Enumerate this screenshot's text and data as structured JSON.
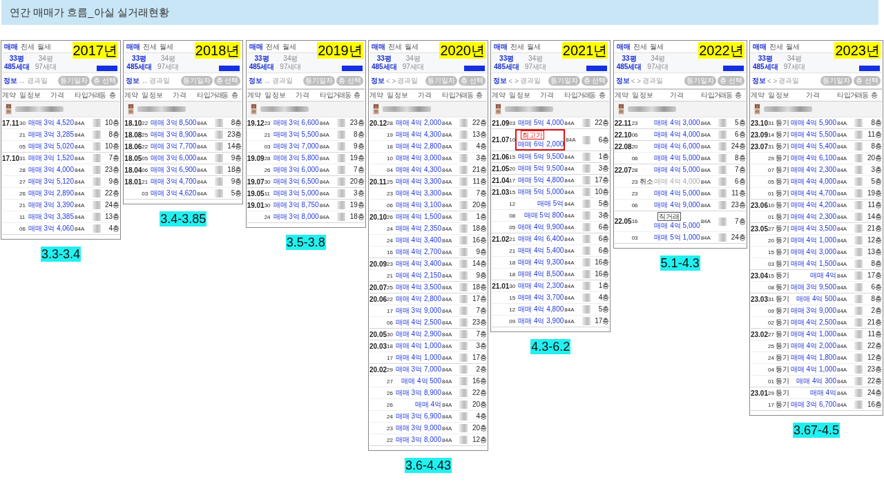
{
  "title": "연간 매매가 흐름_아실 실거래현황",
  "panels": [
    {
      "year": "2017년",
      "range": "3.3-3.4",
      "tabs": [
        {
          "label": "매매",
          "selected": true
        },
        {
          "label": "전세",
          "selected": false
        },
        {
          "label": "월세",
          "selected": false
        }
      ],
      "areas": [
        {
          "size": "33평",
          "units": "485세대",
          "selected": true
        },
        {
          "size": "34평",
          "units": "97세대",
          "selected": false
        }
      ],
      "filter": {
        "info": "정보",
        "separator": "↔",
        "elapsed": "경과일"
      },
      "buttons": [
        "등기일자",
        "층 선택"
      ],
      "columns": [
        "계약",
        "일",
        "정보",
        "가격",
        "타입",
        "거래동",
        "층"
      ],
      "months": [
        {
          "month": "17.11",
          "rows": [
            {
              "day": "30",
              "deal": "매매",
              "price": "3억 4,520",
              "type": "84A",
              "floor": "10층"
            },
            {
              "day": "21",
              "deal": "매매",
              "price": "3억 3,285",
              "type": "84A",
              "floor": "8층"
            },
            {
              "day": "05",
              "deal": "매매",
              "price": "3억 5,020",
              "type": "84A",
              "floor": "10층"
            }
          ]
        },
        {
          "month": "17.10",
          "rows": [
            {
              "day": "31",
              "deal": "매매",
              "price": "3억 1,520",
              "type": "84A",
              "floor": "7층"
            },
            {
              "day": "28",
              "deal": "매매",
              "price": "3억 4,000",
              "type": "84A",
              "floor": "23층"
            },
            {
              "day": "27",
              "deal": "매매",
              "price": "3억 5,120",
              "type": "84A",
              "floor": "9층"
            },
            {
              "day": "26",
              "deal": "매매",
              "price": "3억 2,890",
              "type": "84A",
              "floor": "22층"
            },
            {
              "day": "21",
              "deal": "매매",
              "price": "3억 3,390",
              "type": "84A",
              "floor": "24층"
            },
            {
              "day": "11",
              "deal": "매매",
              "price": "3억 3,385",
              "type": "84A",
              "floor": "13층"
            },
            {
              "day": "06",
              "deal": "매매",
              "price": "3억 4,060",
              "type": "84A",
              "floor": "4층"
            }
          ]
        }
      ]
    },
    {
      "year": "2018년",
      "range": "3.4-3.85",
      "tabs": [
        {
          "label": "매매",
          "selected": true
        },
        {
          "label": "전세",
          "selected": false
        },
        {
          "label": "월세",
          "selected": false
        }
      ],
      "areas": [
        {
          "size": "33평",
          "units": "485세대",
          "selected": true
        },
        {
          "size": "34평",
          "units": "97세대",
          "selected": false
        }
      ],
      "filter": {
        "info": "정보",
        "separator": "↔",
        "elapsed": "경과일"
      },
      "buttons": [
        "등기일자",
        "층 선택"
      ],
      "columns": [
        "계약",
        "일",
        "정보",
        "가격",
        "타입",
        "거래동",
        "층"
      ],
      "months": [
        {
          "month": "18.10",
          "rows": [
            {
              "day": "22",
              "deal": "매매",
              "price": "3억 8,500",
              "type": "84A",
              "floor": "8층"
            }
          ]
        },
        {
          "month": "18.08",
          "rows": [
            {
              "day": "25",
              "deal": "매매",
              "price": "3억 8,900",
              "type": "84A",
              "floor": "23층"
            }
          ]
        },
        {
          "month": "18.06",
          "rows": [
            {
              "day": "22",
              "deal": "매매",
              "price": "3억 7,700",
              "type": "84A",
              "floor": "14층"
            }
          ]
        },
        {
          "month": "18.05",
          "rows": [
            {
              "day": "05",
              "deal": "매매",
              "price": "3억 6,000",
              "type": "84A",
              "floor": "9층"
            }
          ]
        },
        {
          "month": "18.04",
          "rows": [
            {
              "day": "06",
              "deal": "매매",
              "price": "3억 6,900",
              "type": "84A",
              "floor": "18층"
            }
          ]
        },
        {
          "month": "18.01",
          "rows": [
            {
              "day": "21",
              "deal": "매매",
              "price": "3억 4,700",
              "type": "84A",
              "floor": "9층"
            },
            {
              "day": "03",
              "deal": "매매",
              "price": "3억 4,620",
              "type": "84A",
              "floor": "5층"
            }
          ]
        }
      ]
    },
    {
      "year": "2019년",
      "range": "3.5-3.8",
      "tabs": [
        {
          "label": "매매",
          "selected": true
        },
        {
          "label": "전세",
          "selected": false
        },
        {
          "label": "월세",
          "selected": false
        }
      ],
      "areas": [
        {
          "size": "33평",
          "units": "485세대",
          "selected": true
        },
        {
          "size": "34평",
          "units": "97세대",
          "selected": false
        }
      ],
      "filter": {
        "info": "정보",
        "separator": "↔",
        "elapsed": "경과일"
      },
      "buttons": [
        "등기일자",
        "층 선택"
      ],
      "columns": [
        "계약",
        "일",
        "정보",
        "가격",
        "타입",
        "거래동",
        "층"
      ],
      "months": [
        {
          "month": "19.12",
          "rows": [
            {
              "day": "23",
              "deal": "매매",
              "price": "3억 6,600",
              "type": "84A",
              "floor": "23층"
            },
            {
              "day": "21",
              "deal": "매매",
              "price": "3억 5,500",
              "type": "84A",
              "floor": "8층"
            },
            {
              "day": "03",
              "deal": "매매",
              "price": "3억 7,000",
              "type": "84A",
              "floor": "9층"
            }
          ]
        },
        {
          "month": "19.09",
          "rows": [
            {
              "day": "28",
              "deal": "매매",
              "price": "3억 5,800",
              "type": "84A",
              "floor": "19층"
            },
            {
              "day": "26",
              "deal": "매매",
              "price": "3억 6,000",
              "type": "84A",
              "floor": "7층"
            }
          ]
        },
        {
          "month": "19.07",
          "rows": [
            {
              "day": "30",
              "deal": "매매",
              "price": "3억 6,500",
              "type": "84A",
              "floor": "20층"
            }
          ]
        },
        {
          "month": "19.05",
          "rows": [
            {
              "day": "11",
              "deal": "매매",
              "price": "3억 5,000",
              "type": "84A",
              "floor": "3층"
            }
          ]
        },
        {
          "month": "19.01",
          "rows": [
            {
              "day": "30",
              "deal": "매매",
              "price": "3억 8,750",
              "type": "84A",
              "floor": "19층"
            },
            {
              "day": "24",
              "deal": "매매",
              "price": "3억 8,000",
              "type": "84A",
              "floor": "18층"
            }
          ]
        }
      ]
    },
    {
      "year": "2020년",
      "range": "3.6-4.43",
      "tabs": [
        {
          "label": "매매",
          "selected": true
        },
        {
          "label": "전세",
          "selected": false
        },
        {
          "label": "월세",
          "selected": false
        }
      ],
      "areas": [
        {
          "size": "33평",
          "units": "485세대",
          "selected": true
        },
        {
          "size": "34평",
          "units": "97세대",
          "selected": false
        }
      ],
      "filter": {
        "info": "정보",
        "separator": "< >",
        "elapsed": "경과일"
      },
      "buttons": [
        "등기일자",
        "층 선택"
      ],
      "columns": [
        "계약",
        "일",
        "정보",
        "가격",
        "타입",
        "거래동",
        "층"
      ],
      "months": [
        {
          "month": "20.12",
          "rows": [
            {
              "day": "28",
              "deal": "매매",
              "price": "4억 2,000",
              "type": "84A",
              "floor": "22층"
            },
            {
              "day": "19",
              "deal": "매매",
              "price": "4억 4,300",
              "type": "84A",
              "floor": "13층"
            },
            {
              "day": "18",
              "deal": "매매",
              "price": "4억 2,800",
              "type": "84A",
              "floor": "4층"
            },
            {
              "day": "10",
              "deal": "매매",
              "price": "4억 3,000",
              "type": "84A",
              "floor": "3층"
            },
            {
              "day": "04",
              "deal": "매매",
              "price": "4억 4,300",
              "type": "84A",
              "floor": "21층"
            }
          ]
        },
        {
          "month": "20.11",
          "rows": [
            {
              "day": "25",
              "deal": "매매",
              "price": "4억 3,300",
              "type": "84A",
              "floor": "11층"
            },
            {
              "day": "23",
              "deal": "매매",
              "price": "4억 3,300",
              "type": "84A",
              "floor": "7층"
            },
            {
              "day": "06",
              "deal": "매매",
              "price": "4억 3,100",
              "type": "84A",
              "floor": "20층"
            }
          ]
        },
        {
          "month": "20.10",
          "rows": [
            {
              "day": "26",
              "deal": "매매",
              "price": "4억 1,500",
              "type": "84A",
              "floor": "1층"
            },
            {
              "day": "24",
              "deal": "매매",
              "price": "4억 2,350",
              "type": "84A",
              "floor": "18층"
            },
            {
              "day": "24",
              "deal": "매매",
              "price": "4억 3,400",
              "type": "84A",
              "floor": "16층"
            },
            {
              "day": "16",
              "deal": "매매",
              "price": "4억 2,700",
              "type": "84A",
              "floor": "9층"
            }
          ]
        },
        {
          "month": "20.09",
          "rows": [
            {
              "day": "23",
              "deal": "매매",
              "price": "4억 3,400",
              "type": "84A",
              "floor": "14층"
            },
            {
              "day": "21",
              "deal": "매매",
              "price": "4억 2,150",
              "type": "84A",
              "floor": "9층"
            }
          ]
        },
        {
          "month": "20.07",
          "rows": [
            {
              "day": "25",
              "deal": "매매",
              "price": "4억 3,500",
              "type": "84A",
              "floor": "18층"
            }
          ]
        },
        {
          "month": "20.06",
          "rows": [
            {
              "day": "22",
              "deal": "매매",
              "price": "4억 2,800",
              "type": "84A",
              "floor": "17층"
            },
            {
              "day": "17",
              "deal": "매매",
              "price": "3억 9,000",
              "type": "84A",
              "floor": "7층"
            },
            {
              "day": "06",
              "deal": "매매",
              "price": "4억 2,500",
              "type": "84A",
              "floor": "23층"
            }
          ]
        },
        {
          "month": "20.05",
          "rows": [
            {
              "day": "30",
              "deal": "매매",
              "price": "4억 2,900",
              "type": "84A",
              "floor": "7층"
            }
          ]
        },
        {
          "month": "20.03",
          "rows": [
            {
              "day": "18",
              "deal": "매매",
              "price": "4억 1,000",
              "type": "84A",
              "floor": "3층"
            },
            {
              "day": "17",
              "deal": "매매",
              "price": "4억 1,000",
              "type": "84A",
              "floor": "17층"
            }
          ]
        },
        {
          "month": "20.02",
          "rows": [
            {
              "day": "29",
              "deal": "매매",
              "price": "3억 7,000",
              "type": "84A",
              "floor": "2층"
            },
            {
              "day": "27",
              "deal": "매매",
              "price": "4억 500",
              "type": "84A",
              "floor": "16층"
            },
            {
              "day": "26",
              "deal": "매매",
              "price": "3억 8,900",
              "type": "84A",
              "floor": "22층"
            },
            {
              "day": "26",
              "deal": "매매",
              "price": "4억",
              "type": "84A",
              "floor": "20층"
            },
            {
              "day": "24",
              "deal": "매매",
              "price": "3억 6,900",
              "type": "84A",
              "floor": "4층"
            },
            {
              "day": "23",
              "deal": "매매",
              "price": "3억 9,000",
              "type": "84A",
              "floor": "20층"
            },
            {
              "day": "22",
              "deal": "매매",
              "price": "3억 8,000",
              "type": "84A",
              "floor": "12층"
            }
          ]
        }
      ]
    },
    {
      "year": "2021년",
      "range": "4.3-6.2",
      "tabs": [
        {
          "label": "매매",
          "selected": true
        },
        {
          "label": "전세",
          "selected": false
        },
        {
          "label": "월세",
          "selected": false
        }
      ],
      "areas": [
        {
          "size": "33평",
          "units": "485세대",
          "selected": true
        },
        {
          "size": "34평",
          "units": "97세대",
          "selected": false
        }
      ],
      "filter": {
        "info": "정보",
        "separator": "< >",
        "elapsed": "경과일"
      },
      "buttons": [
        "등기일자",
        "층 선택"
      ],
      "columns": [
        "계약",
        "일",
        "정보",
        "가격",
        "타입",
        "거래동",
        "층"
      ],
      "months": [
        {
          "month": "21.09",
          "rows": [
            {
              "day": "03",
              "deal": "매매",
              "price": "5억 4,000",
              "type": "84A",
              "floor": "22층",
              "highlighted": false
            }
          ]
        },
        {
          "month": "21.07",
          "rows": [
            {
              "day": "10",
              "deal": "매매",
              "price": "6억 2,000",
              "type": "84A",
              "floor": "6층",
              "highlighted": true,
              "badge": {
                "text": "최고가",
                "kind": "record"
              }
            }
          ]
        },
        {
          "month": "21.06",
          "rows": [
            {
              "day": "15",
              "deal": "매매",
              "price": "5억 9,500",
              "type": "84A",
              "floor": "1층",
              "highlighted": false
            }
          ]
        },
        {
          "month": "21.05",
          "rows": [
            {
              "day": "20",
              "deal": "매매",
              "price": "5억 9,500",
              "type": "84A",
              "floor": "3층",
              "highlighted": false
            }
          ]
        },
        {
          "month": "21.04",
          "rows": [
            {
              "day": "17",
              "deal": "매매",
              "price": "5억 4,800",
              "type": "84A",
              "floor": "17층",
              "highlighted": false
            }
          ]
        },
        {
          "month": "21.03",
          "rows": [
            {
              "day": "15",
              "deal": "매매",
              "price": "5억 5,000",
              "type": "84A",
              "floor": "10층",
              "highlighted": false
            },
            {
              "day": "12",
              "deal": "매매",
              "price": "5억",
              "type": "84A",
              "floor": "5층",
              "highlighted": false
            },
            {
              "day": "08",
              "deal": "매매",
              "price": "5억 800",
              "type": "84A",
              "floor": "3층",
              "highlighted": false
            },
            {
              "day": "05",
              "deal": "매매",
              "price": "4억 9,900",
              "type": "84A",
              "floor": "6층",
              "highlighted": false
            }
          ]
        },
        {
          "month": "21.02",
          "rows": [
            {
              "day": "21",
              "deal": "매매",
              "price": "4억 6,400",
              "type": "84A",
              "floor": "6층",
              "highlighted": false
            },
            {
              "day": "21",
              "deal": "매매",
              "price": "4억 5,400",
              "type": "84A",
              "floor": "6층",
              "highlighted": false
            },
            {
              "day": "18",
              "deal": "매매",
              "price": "4억 9,300",
              "type": "84A",
              "floor": "16층",
              "highlighted": false
            },
            {
              "day": "18",
              "deal": "매매",
              "price": "4억 8,500",
              "type": "84A",
              "floor": "16층",
              "highlighted": false
            }
          ]
        },
        {
          "month": "21.01",
          "rows": [
            {
              "day": "30",
              "deal": "매매",
              "price": "4억 2,300",
              "type": "84A",
              "floor": "1층",
              "highlighted": false
            },
            {
              "day": "15",
              "deal": "매매",
              "price": "4억 3,700",
              "type": "84A",
              "floor": "4층",
              "highlighted": false
            },
            {
              "day": "12",
              "deal": "매매",
              "price": "4억 4,800",
              "type": "84A",
              "floor": "5층",
              "highlighted": false
            },
            {
              "day": "09",
              "deal": "매매",
              "price": "4억 3,900",
              "type": "84A",
              "floor": "17층",
              "highlighted": false
            }
          ]
        }
      ]
    },
    {
      "year": "2022년",
      "range": "5.1-4.3",
      "tabs": [
        {
          "label": "매매",
          "selected": true
        },
        {
          "label": "전세",
          "selected": false
        },
        {
          "label": "월세",
          "selected": false
        }
      ],
      "areas": [
        {
          "size": "33평",
          "units": "485세대",
          "selected": true
        },
        {
          "size": "34평",
          "units": "97세대",
          "selected": false
        }
      ],
      "filter": {
        "info": "정보",
        "separator": "< >",
        "elapsed": "경과일"
      },
      "buttons": [
        "등기일자",
        "층 선택"
      ],
      "columns": [
        "계약",
        "일",
        "정보",
        "가격",
        "타입",
        "거래동",
        "층"
      ],
      "months": [
        {
          "month": "22.11",
          "rows": [
            {
              "day": "23",
              "deal": "매매",
              "price": "4억 3,000",
              "type": "84A",
              "floor": "5층",
              "cancelled": false
            }
          ]
        },
        {
          "month": "22.10",
          "rows": [
            {
              "day": "06",
              "deal": "매매",
              "price": "4억 4,000",
              "type": "84A",
              "floor": "6층",
              "cancelled": false
            }
          ]
        },
        {
          "month": "22.08",
          "rows": [
            {
              "day": "20",
              "deal": "매매",
              "price": "4억 6,000",
              "type": "84A",
              "floor": "24층",
              "cancelled": false
            },
            {
              "day": "06",
              "deal": "매매",
              "price": "4억 5,000",
              "type": "84A",
              "floor": "8층",
              "cancelled": false
            }
          ]
        },
        {
          "month": "22.07",
          "rows": [
            {
              "day": "28",
              "deal": "매매",
              "price": "4억 5,000",
              "type": "84A",
              "floor": "7층",
              "cancelled": false
            },
            {
              "day": "23",
              "info": "취소",
              "deal": "매매",
              "price": "4억 4,000",
              "type": "84A",
              "floor": "6층",
              "cancelled": true
            },
            {
              "day": "23",
              "deal": "매매",
              "price": "4억 5,000",
              "type": "84A",
              "floor": "11층",
              "cancelled": false
            },
            {
              "day": "06",
              "deal": "매매",
              "price": "4억 9,000",
              "type": "84A",
              "floor": "23층",
              "cancelled": false
            }
          ]
        },
        {
          "month": "22.05",
          "rows": [
            {
              "day": "16",
              "deal": "매매",
              "price": "4억 5,000",
              "type": "84A",
              "floor": "7층",
              "cancelled": false,
              "badge": {
                "text": "직거래",
                "kind": "direct"
              }
            },
            {
              "day": "03",
              "deal": "매매",
              "price": "5억 1,000",
              "type": "84A",
              "floor": "24층",
              "cancelled": false
            }
          ]
        }
      ]
    },
    {
      "year": "2023년",
      "range": "3.67-4.5",
      "tabs": [
        {
          "label": "매매",
          "selected": true
        },
        {
          "label": "전세",
          "selected": false
        },
        {
          "label": "월세",
          "selected": false
        }
      ],
      "areas": [
        {
          "size": "33평",
          "units": "485세대",
          "selected": true
        },
        {
          "size": "34평",
          "units": "97세대",
          "selected": false
        }
      ],
      "filter": {
        "info": "정보",
        "separator": "< >",
        "elapsed": "경과일"
      },
      "buttons": [
        "등기일자",
        "층 선택"
      ],
      "columns": [
        "계약",
        "일",
        "정보",
        "가격",
        "타입",
        "거래동",
        "층"
      ],
      "months": [
        {
          "month": "23.10",
          "rows": [
            {
              "day": "31",
              "info": "등기",
              "deal": "매매",
              "price": "4억 5,900",
              "type": "84A",
              "floor": "8층"
            }
          ]
        },
        {
          "month": "23.09",
          "rows": [
            {
              "day": "14",
              "info": "등기",
              "deal": "매매",
              "price": "4억 5,500",
              "type": "84A",
              "floor": "11층"
            }
          ]
        },
        {
          "month": "23.07",
          "rows": [
            {
              "day": "31",
              "info": "등기",
              "deal": "매매",
              "price": "4억 5,400",
              "type": "84A",
              "floor": "8층"
            },
            {
              "day": "29",
              "info": "등기",
              "deal": "매매",
              "price": "4억 6,100",
              "type": "84A",
              "floor": "20층"
            },
            {
              "day": "07",
              "info": "등기",
              "deal": "매매",
              "price": "4억 2,300",
              "type": "84A",
              "floor": "3층"
            },
            {
              "day": "05",
              "info": "등기",
              "deal": "매매",
              "price": "4억 4,000",
              "type": "84A",
              "floor": "5층"
            },
            {
              "day": "01",
              "info": "등기",
              "deal": "매매",
              "price": "4억 4,700",
              "type": "84A",
              "floor": "19층"
            }
          ]
        },
        {
          "month": "23.06",
          "rows": [
            {
              "day": "10",
              "info": "등기",
              "deal": "매매",
              "price": "4억 4,200",
              "type": "84A",
              "floor": "11층"
            },
            {
              "day": "01",
              "info": "등기",
              "deal": "매매",
              "price": "4억 2,300",
              "type": "84A",
              "floor": "14층"
            }
          ]
        },
        {
          "month": "23.05",
          "rows": [
            {
              "day": "27",
              "info": "등기",
              "deal": "매매",
              "price": "4억 3,500",
              "type": "84A",
              "floor": "21층"
            },
            {
              "day": "20",
              "info": "등기",
              "deal": "매매",
              "price": "4억 1,000",
              "type": "84A",
              "floor": "12층"
            },
            {
              "day": "15",
              "info": "등기",
              "deal": "매매",
              "price": "4억 3,000",
              "type": "84A",
              "floor": "13층"
            },
            {
              "day": "03",
              "info": "등기",
              "deal": "매매",
              "price": "4억 1,500",
              "type": "84A",
              "floor": "8층"
            }
          ]
        },
        {
          "month": "23.04",
          "rows": [
            {
              "day": "15",
              "info": "등기",
              "deal": "매매",
              "price": "4억",
              "type": "84A",
              "floor": "17층"
            },
            {
              "day": "08",
              "info": "등기",
              "deal": "매매",
              "price": "3억 9,500",
              "type": "84A",
              "floor": "6층"
            }
          ]
        },
        {
          "month": "23.03",
          "rows": [
            {
              "day": "31",
              "info": "등기",
              "deal": "매매",
              "price": "4억 500",
              "type": "84A",
              "floor": "8층"
            },
            {
              "day": "09",
              "info": "등기",
              "deal": "매매",
              "price": "3억 9,000",
              "type": "84A",
              "floor": "2층"
            },
            {
              "day": "02",
              "info": "등기",
              "deal": "매매",
              "price": "4억 2,500",
              "type": "84A",
              "floor": "21층"
            }
          ]
        },
        {
          "month": "23.02",
          "rows": [
            {
              "day": "27",
              "info": "등기",
              "deal": "매매",
              "price": "4억 1,000",
              "type": "84A",
              "floor": "11층"
            },
            {
              "day": "25",
              "info": "등기",
              "deal": "매매",
              "price": "4억 2,000",
              "type": "84A",
              "floor": "22층"
            },
            {
              "day": "24",
              "info": "등기",
              "deal": "매매",
              "price": "4억 1,800",
              "type": "84A",
              "floor": "12층"
            },
            {
              "day": "04",
              "info": "등기",
              "deal": "매매",
              "price": "4억 1,000",
              "type": "84A",
              "floor": "23층"
            },
            {
              "day": "01",
              "info": "등기",
              "deal": "매매",
              "price": "4억 300",
              "type": "84A",
              "floor": "22층"
            }
          ]
        },
        {
          "month": "23.01",
          "rows": [
            {
              "day": "29",
              "info": "등기",
              "deal": "매매",
              "price": "4억",
              "type": "84A",
              "floor": "24층"
            },
            {
              "day": "17",
              "info": "등기",
              "deal": "매매",
              "price": "3억 6,700",
              "type": "84A",
              "floor": "16층"
            }
          ]
        }
      ]
    }
  ]
}
